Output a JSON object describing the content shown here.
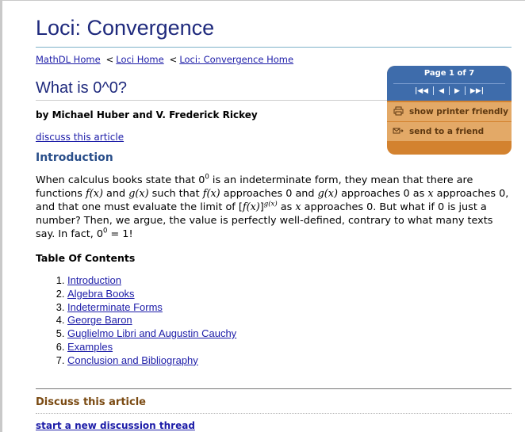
{
  "site": {
    "title": "Loci: Convergence"
  },
  "breadcrumb": {
    "items": [
      {
        "label": "MathDL Home"
      },
      {
        "label": "Loci Home"
      },
      {
        "label": "Loci: Convergence Home"
      }
    ],
    "separator": "<"
  },
  "article": {
    "title": "What is 0^0?",
    "byline": "by Michael Huber and V. Frederick Rickey",
    "discuss_link": "discuss this article",
    "intro_heading": "Introduction",
    "intro": {
      "s1": "When calculus books state that 0",
      "sup0a": "0",
      "s2": " is an indeterminate form, they mean that there are functions ",
      "fx1": "f(x)",
      "s3": " and ",
      "gx1": "g(x)",
      "s4": " such that ",
      "fx2": "f(x)",
      "s5": " approaches 0 and ",
      "gx2": "g(x)",
      "s6": " approaches 0 as ",
      "x1": "x",
      "s7": " approaches 0, and that one must evaluate the limit of [",
      "fx3": "f(x)",
      "s8": "]",
      "supgx": "g(x)",
      "s9": " as ",
      "x2": "x",
      "s10": " approaches 0. But what if 0 is just a number? Then, we argue, the value is perfectly well-defined, contrary to what many texts say. In fact, 0",
      "sup0b": "0",
      "s11": " = 1!"
    },
    "toc_title": "Table Of Contents",
    "toc": [
      "Introduction",
      "Algebra Books",
      "Indeterminate Forms",
      "George Baron",
      "Guglielmo Libri and Augustin Cauchy",
      "Examples",
      "Conclusion and Bibliography"
    ]
  },
  "panel": {
    "page_indicator": "Page 1 of 7",
    "pager": {
      "first": "|◀◀",
      "prev": "◀",
      "next": "▶",
      "last": "▶▶|"
    },
    "printer_label": "show printer friendly",
    "printer_icon": "printer-icon",
    "send_label": "send to a friend",
    "send_icon": "email-icon",
    "colors": {
      "head": "#3e6cab",
      "body": "#d3822f",
      "row": "#e3a967"
    }
  },
  "discussion": {
    "heading": "Discuss this article",
    "new_thread": "start a new discussion thread"
  }
}
